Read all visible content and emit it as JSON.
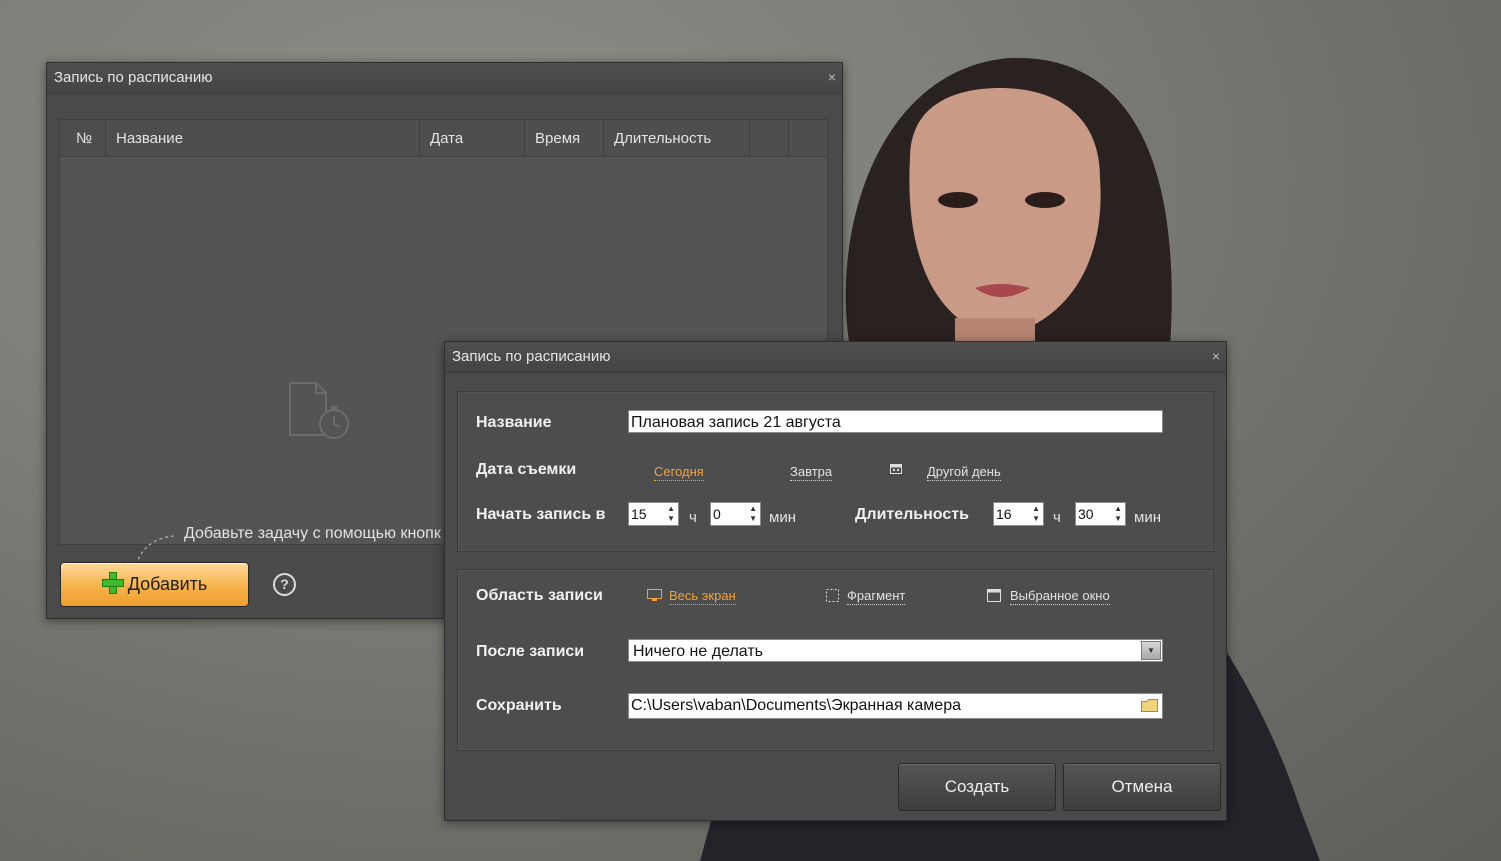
{
  "colors": {
    "accent": "#f0a43a",
    "window_bg": "#4a4a4a",
    "add_button": "#f6b24a"
  },
  "back_window": {
    "title": "Запись по расписанию",
    "close": "×",
    "columns": [
      "№",
      "Название",
      "Дата",
      "Время",
      "Длительность"
    ],
    "empty_hint": "Добавьте задачу с помощью кнопк",
    "add_label": "Добавить",
    "help": "?"
  },
  "dialog": {
    "title": "Запись по расписанию",
    "close": "×",
    "name_label": "Название",
    "name_value": "Плановая запись 21 августа",
    "date_label": "Дата съемки",
    "date_options": [
      "Сегодня",
      "Завтра",
      "Другой день"
    ],
    "date_selected": "Сегодня",
    "start_label": "Начать запись в",
    "start_hours": "15",
    "start_minutes": "0",
    "hours_unit": "ч",
    "minutes_unit": "мин",
    "duration_label": "Длительность",
    "duration_hours": "16",
    "duration_minutes": "30",
    "area_label": "Область записи",
    "area_options": [
      "Весь экран",
      "Фрагмент",
      "Выбранное окно"
    ],
    "area_selected": "Весь экран",
    "after_label": "После записи",
    "after_value": "Ничего не делать",
    "save_label": "Сохранить",
    "save_path": "C:\\Users\\vaban\\Documents\\Экранная камера",
    "create_label": "Создать",
    "cancel_label": "Отмена"
  }
}
